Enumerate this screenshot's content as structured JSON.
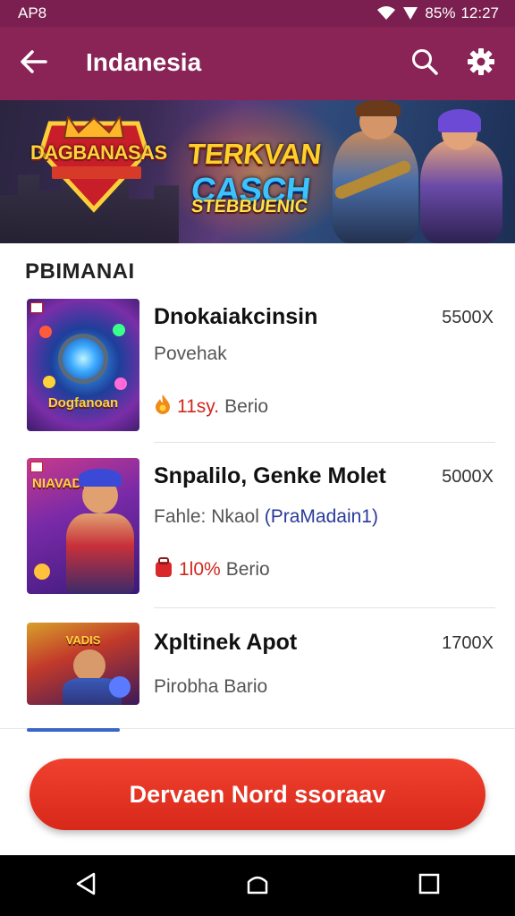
{
  "status_bar": {
    "left_text": "AP8",
    "battery": "85%",
    "time": "12:27",
    "icons": [
      "wifi-icon",
      "signal-icon"
    ]
  },
  "app_bar": {
    "title": "Indanesia",
    "icons": [
      "back-arrow-icon",
      "search-icon",
      "gear-icon"
    ]
  },
  "banner": {
    "logo_title": "DAGBANASAS",
    "logo_subtitle": "",
    "headline_line1": "TERKVAN",
    "headline_line2": "CASCH",
    "headline_line3": "STEBBUENIC"
  },
  "section": {
    "title": "PBIMANAI"
  },
  "items": [
    {
      "title": "Dnokaiakcinsin",
      "price": "5500X",
      "subtitle": "Povehak",
      "meta_hot": "11sy.",
      "meta_text": "Berio",
      "meta_icon": "flame-icon",
      "thumb_text": "Dogfanoan"
    },
    {
      "title": "Snpalilo, Genke Molet",
      "price": "5000X",
      "subtitle": "Fahle: Nkaol",
      "subtitle_tag": "(PraMadain1)",
      "meta_hot": "1l0%",
      "meta_text": "Berio",
      "meta_icon": "bag-icon",
      "thumb_text": "NIAVADS"
    },
    {
      "title": "Xpltinek Apot",
      "price": "1700X",
      "subtitle": "Pirobha Bario",
      "thumb_text": "VADIS"
    }
  ],
  "cta": {
    "label": "Dervaen Nord ssoraav"
  },
  "nav_bar": {
    "icons": [
      "back-triangle-icon",
      "home-icon",
      "recents-square-icon"
    ]
  },
  "colors": {
    "status_bar": "#7a1f4f",
    "app_bar": "#8a2457",
    "cta": "#e23424",
    "accent_link": "#2a3a9a",
    "hot_text": "#d0281e"
  }
}
